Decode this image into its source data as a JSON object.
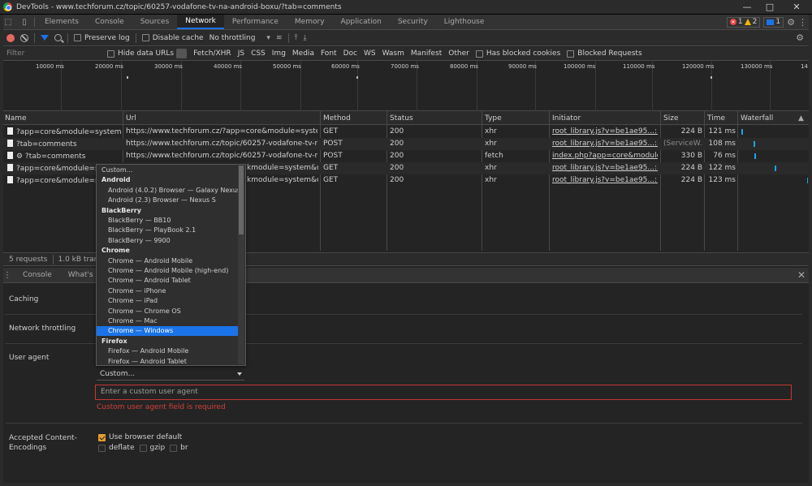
{
  "window": {
    "title": "DevTools - www.techforum.cz/topic/60257-vodafone-tv-na-android-boxu/?tab=comments",
    "minimize": "—",
    "maximize": "□",
    "close": "✕"
  },
  "tabs": [
    "Elements",
    "Console",
    "Sources",
    "Network",
    "Performance",
    "Memory",
    "Application",
    "Security",
    "Lighthouse"
  ],
  "active_tab": "Network",
  "badges": {
    "errors": "1",
    "warnings": "2",
    "messages": "1"
  },
  "toolbar": {
    "preserve_log": "Preserve log",
    "disable_cache": "Disable cache",
    "throttling": "No throttling"
  },
  "filterbar": {
    "placeholder": "Filter",
    "hide_data_urls": "Hide data URLs",
    "types": [
      "Fetch/XHR",
      "JS",
      "CSS",
      "Img",
      "Media",
      "Font",
      "Doc",
      "WS",
      "Wasm",
      "Manifest",
      "Other"
    ],
    "has_blocked_cookies": "Has blocked cookies",
    "blocked_requests": "Blocked Requests"
  },
  "overview_ticks": [
    "10000 ms",
    "20000 ms",
    "30000 ms",
    "40000 ms",
    "50000 ms",
    "60000 ms",
    "70000 ms",
    "80000 ms",
    "90000 ms",
    "100000 ms",
    "110000 ms",
    "120000 ms",
    "130000 ms",
    "14"
  ],
  "columns": [
    "Name",
    "Url",
    "Method",
    "Status",
    "Type",
    "Initiator",
    "Size",
    "Time",
    "Waterfall"
  ],
  "rows": [
    {
      "name": "?app=core&module=system&...",
      "url": "https://www.techforum.cz/?app=core&module=system&co...",
      "method": "GET",
      "status": "200",
      "type": "xhr",
      "initiator": "root_library.js?v=be1ae95...:1",
      "size": "224 B",
      "time": "121 ms"
    },
    {
      "name": "?tab=comments",
      "url": "https://www.techforum.cz/topic/60257-vodafone-tv-na-an...",
      "method": "POST",
      "status": "200",
      "type": "xhr",
      "initiator": "root_library.js?v=be1ae95...:1",
      "size": "(ServiceW...",
      "time": "108 ms"
    },
    {
      "name": "⚙ ?tab=comments",
      "url": "https://www.techforum.cz/topic/60257-vodafone-tv-na-an...",
      "method": "POST",
      "status": "200",
      "type": "fetch",
      "initiator": "index.php?app=core&module=...",
      "size": "330 B",
      "time": "76 ms"
    },
    {
      "name": "?app=core&module=syst",
      "url": "kmodule=system&co...",
      "method": "GET",
      "status": "200",
      "type": "xhr",
      "initiator": "root_library.js?v=be1ae95...:1",
      "size": "224 B",
      "time": "122 ms"
    },
    {
      "name": "?app=core&module=syst",
      "url": "kmodule=system&co...",
      "method": "GET",
      "status": "200",
      "type": "xhr",
      "initiator": "root_library.js?v=be1ae95...:1",
      "size": "224 B",
      "time": "123 ms"
    }
  ],
  "status": {
    "requests": "5 requests",
    "transferred": "1.0 kB transfe"
  },
  "drawer_tabs": [
    "Console",
    "What's New"
  ],
  "settings": {
    "caching": "Caching",
    "throttling": "Network throttling",
    "user_agent": "User agent",
    "accepted_encodings": "Accepted Content-Encodings",
    "select_value": "Custom...",
    "ua_placeholder": "Enter a custom user agent",
    "ua_error": "Custom user agent field is required",
    "use_browser_default": "Use browser default",
    "deflate": "deflate",
    "gzip": "gzip",
    "br": "br"
  },
  "dropdown": [
    {
      "label": "Custom...",
      "kind": "top"
    },
    {
      "label": "Android",
      "kind": "group"
    },
    {
      "label": "Android (4.0.2) Browser — Galaxy Nexus",
      "kind": "item"
    },
    {
      "label": "Android (2.3) Browser — Nexus S",
      "kind": "item"
    },
    {
      "label": "BlackBerry",
      "kind": "group"
    },
    {
      "label": "BlackBerry — BB10",
      "kind": "item"
    },
    {
      "label": "BlackBerry — PlayBook 2.1",
      "kind": "item"
    },
    {
      "label": "BlackBerry — 9900",
      "kind": "item"
    },
    {
      "label": "Chrome",
      "kind": "group"
    },
    {
      "label": "Chrome — Android Mobile",
      "kind": "item"
    },
    {
      "label": "Chrome — Android Mobile (high-end)",
      "kind": "item"
    },
    {
      "label": "Chrome — Android Tablet",
      "kind": "item"
    },
    {
      "label": "Chrome — iPhone",
      "kind": "item"
    },
    {
      "label": "Chrome — iPad",
      "kind": "item"
    },
    {
      "label": "Chrome — Chrome OS",
      "kind": "item"
    },
    {
      "label": "Chrome — Mac",
      "kind": "item"
    },
    {
      "label": "Chrome — Windows",
      "kind": "selected"
    },
    {
      "label": "Firefox",
      "kind": "group"
    },
    {
      "label": "Firefox — Android Mobile",
      "kind": "item"
    },
    {
      "label": "Firefox — Android Tablet",
      "kind": "item"
    }
  ],
  "colors": {
    "accent": "#1a73e8",
    "error": "#c6382f",
    "waterfall": "#19a3e8"
  }
}
